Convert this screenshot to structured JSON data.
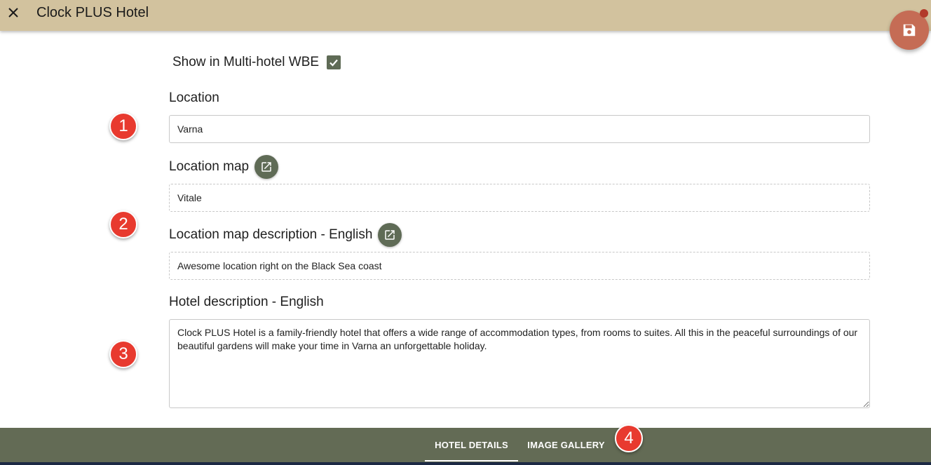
{
  "header": {
    "title": "Clock PLUS Hotel",
    "close_icon": "close-icon"
  },
  "save_button": {
    "icon": "floppy-disk-icon",
    "accent": "#c56c55"
  },
  "multi_hotel": {
    "label": "Show in Multi-hotel WBE",
    "checked": true
  },
  "location": {
    "label": "Location",
    "value": "Varna"
  },
  "location_map": {
    "label": "Location map",
    "value": "Vitale",
    "icon": "open-in-new-icon"
  },
  "location_map_description": {
    "label": "Location map description - English",
    "value": "Awesome location right on the Black Sea coast",
    "icon": "open-in-new-icon"
  },
  "hotel_description": {
    "label": "Hotel description - English",
    "value": "Clock PLUS Hotel is a family-friendly hotel that offers a wide range of accommodation types, from rooms to suites. All this in the peaceful surroundings of our beautiful gardens will make your time in Varna an unforgettable holiday."
  },
  "annotations": [
    "1",
    "2",
    "3",
    "4"
  ],
  "tabs": [
    {
      "label": "HOTEL DETAILS",
      "active": true
    },
    {
      "label": "IMAGE GALLERY",
      "active": false
    }
  ],
  "colors": {
    "header": "#d2c29e",
    "tabbar": "#636b55",
    "badge": "#e83a2f",
    "icon_button": "#5f6b56"
  }
}
